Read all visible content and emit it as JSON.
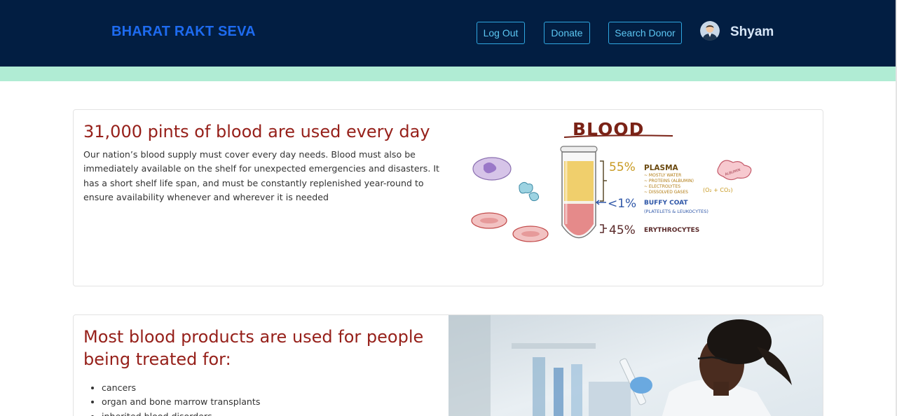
{
  "navbar": {
    "brand": "BHARAT RAKT SEVA",
    "buttons": {
      "logout": "Log Out",
      "donate": "Donate",
      "search_donor": "Search Donor"
    },
    "username": "Shyam",
    "avatar_icon": "user-avatar-icon"
  },
  "colors": {
    "navbar_bg": "#021e42",
    "brand": "#1e6bf0",
    "band": "#b0ecd4",
    "heading": "#96201a"
  },
  "card1": {
    "title": "31,000 pints of blood are used every day",
    "body": "Our nation’s blood supply must cover every day needs. Blood must also be immediately available on the shelf for unexpected emergencies and disasters. It has a short shelf life span, and must be constantly replenished year-round to ensure availability whenever and wherever it is needed",
    "figure": {
      "title": "BLOOD",
      "plasma_pct": "55%",
      "plasma_label": "PLASMA",
      "plasma_items": [
        "~ MOSTLY WATER",
        "~ PROTEINS (ALBUMIN)",
        "~ ELECTROLYTES",
        "~ DISSOLVED GASES"
      ],
      "gases": "(O₂ + CO₂)",
      "buffy_pct": "<1%",
      "buffy_label": "BUFFY COAT",
      "buffy_sub": "(PLATELETS & LEUKOCYTES)",
      "ery_pct": "45%",
      "ery_label": "ERYTHROCYTES",
      "cell_label": "ALBUMIN",
      "plasma_fraction": 0.55,
      "buffy_fraction": 0.01,
      "erythrocyte_fraction": 0.45
    }
  },
  "card2": {
    "title": "Most blood products are used for people being treated for:",
    "list": [
      "cancers",
      "organ and bone marrow transplants",
      "inherited blood disorders"
    ]
  }
}
